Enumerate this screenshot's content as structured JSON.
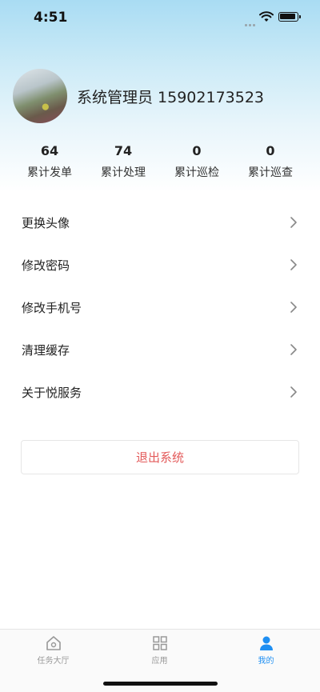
{
  "status_bar": {
    "time": "4:51"
  },
  "profile": {
    "name_phone": "系统管理员 15902173523"
  },
  "stats": [
    {
      "value": "64",
      "label": "累计发单"
    },
    {
      "value": "74",
      "label": "累计处理"
    },
    {
      "value": "0",
      "label": "累计巡检"
    },
    {
      "value": "0",
      "label": "累计巡查"
    }
  ],
  "menu": [
    {
      "label": "更换头像"
    },
    {
      "label": "修改密码"
    },
    {
      "label": "修改手机号"
    },
    {
      "label": "清理缓存"
    },
    {
      "label": "关于悦服务"
    }
  ],
  "logout": {
    "label": "退出系统"
  },
  "tabbar": [
    {
      "label": "任务大厅",
      "icon": "home-icon",
      "active": false
    },
    {
      "label": "应用",
      "icon": "grid-icon",
      "active": false
    },
    {
      "label": "我的",
      "icon": "person-icon",
      "active": true
    }
  ],
  "colors": {
    "accent": "#1f8ff2",
    "danger": "#e35a5a"
  }
}
